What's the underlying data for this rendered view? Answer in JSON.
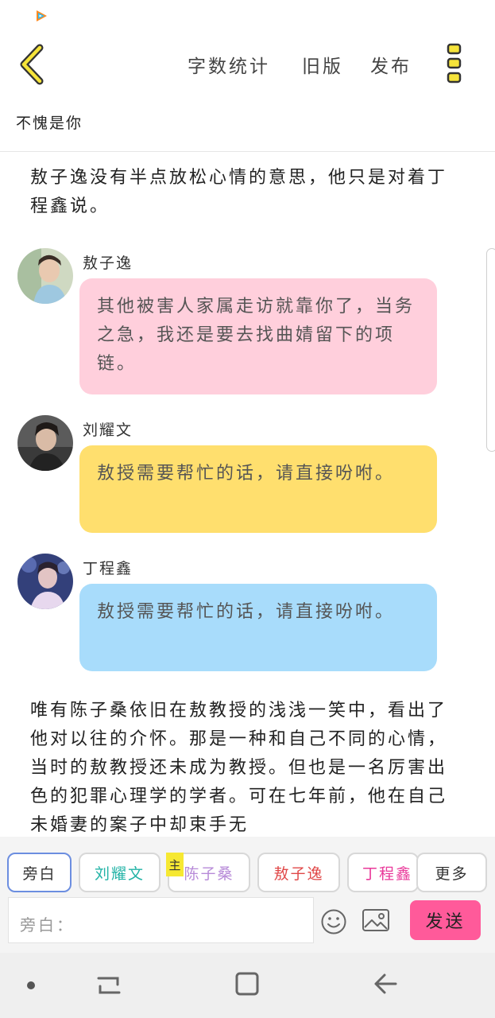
{
  "status_bar": {
    "app_icon": "tencent-video-icon"
  },
  "top_bar": {
    "back_icon": "chevron-left-icon",
    "actions": [
      "字数统计",
      "旧版",
      "发布"
    ],
    "more_icon": "more-vertical-icon"
  },
  "chapter": {
    "title": "不愧是你"
  },
  "story": {
    "narration_1": "敖子逸没有半点放松心情的意思，他只是对着丁程鑫说。",
    "messages": [
      {
        "speaker": "敖子逸",
        "text": "其他被害人家属走访就靠你了，当务之急，我还是要去找曲婧留下的项链。",
        "bubble_color": "#ffcfdc"
      },
      {
        "speaker": "刘耀文",
        "text": "敖授需要帮忙的话，请直接吩咐。",
        "bubble_color": "#ffdf6e"
      },
      {
        "speaker": "丁程鑫",
        "text": "敖授需要帮忙的话，请直接吩咐。",
        "bubble_color": "#a8dcfb"
      }
    ],
    "narration_2": "唯有陈子桑依旧在敖教授的浅浅一笑中，看出了他对以往的介怀。那是一种和自己不同的心情，当时的敖教授还未成为教授。但也是一名厉害出色的犯罪心理学的学者。可在七年前，他在自己未婚妻的案子中却束手无"
  },
  "composer": {
    "roles": [
      {
        "label": "旁白",
        "color": "#333333",
        "active": true
      },
      {
        "label": "刘耀文",
        "color": "#22b3a6",
        "active": false
      },
      {
        "label": "陈子桑",
        "color": "#b78ad8",
        "active": false
      },
      {
        "label": "敖子逸",
        "color": "#e04848",
        "active": false
      },
      {
        "label": "丁程鑫",
        "color": "#e9399a",
        "active": false
      },
      {
        "label": "更多",
        "color": "#333333",
        "active": false
      }
    ],
    "main_badge": "主",
    "input_placeholder": "旁白：",
    "send_label": "发送"
  },
  "colors": {
    "accent": "#ff5a9a",
    "selected_chip_border": "#6c8ee0"
  }
}
